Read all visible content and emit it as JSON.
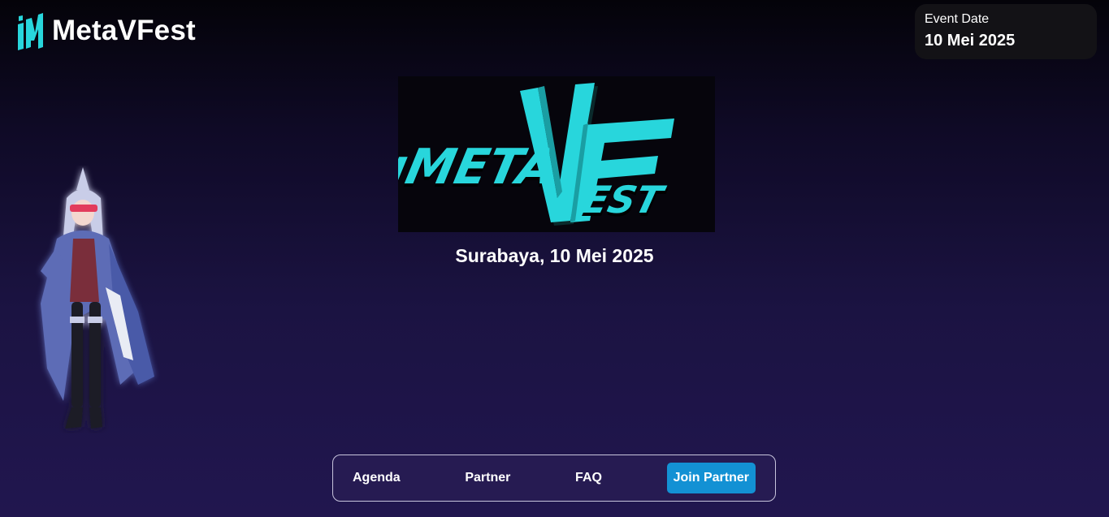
{
  "brand": {
    "name": "MetaVFest",
    "icon": "metavfest-logo-icon",
    "accent_color": "#28d6dc"
  },
  "event": {
    "label": "Event Date",
    "value": "10 Mei 2025"
  },
  "hero": {
    "logo_text": "METAVFEST",
    "subtitle": "Surabaya, 10 Mei 2025"
  },
  "nav": {
    "items": [
      {
        "label": "Agenda"
      },
      {
        "label": "Partner"
      },
      {
        "label": "FAQ"
      }
    ],
    "cta_label": "Join Partner",
    "cta_color": "#1391d4"
  }
}
